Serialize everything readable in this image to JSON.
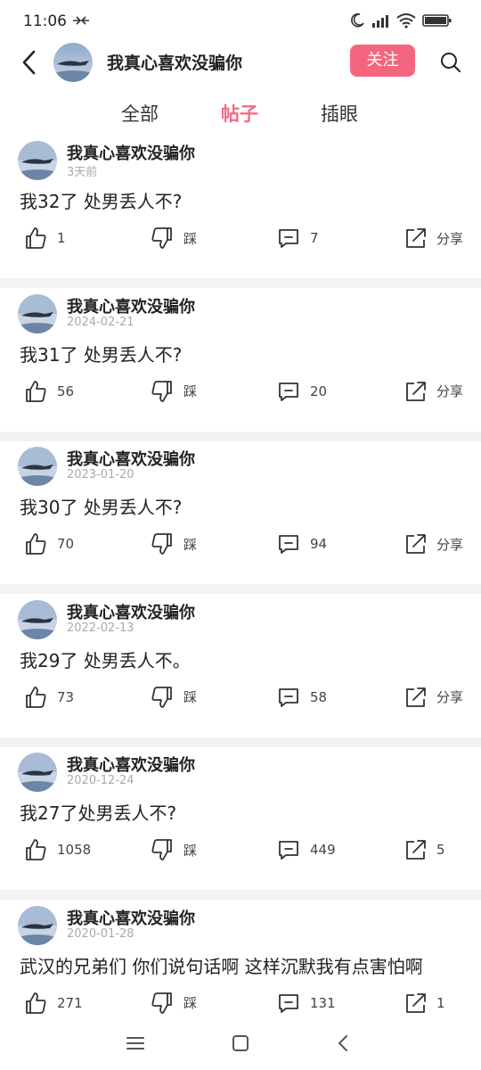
{
  "status_bar": {
    "time": "11:06"
  },
  "header": {
    "username": "我真心喜欢没骗你",
    "follow_label": "关注"
  },
  "tabs": [
    {
      "label": "全部",
      "active": false
    },
    {
      "label": "帖子",
      "active": true
    },
    {
      "label": "插眼",
      "active": false
    }
  ],
  "posts": [
    {
      "name": "我真心喜欢没骗你",
      "date": "3天前",
      "text": "我32了 处男丢人不?",
      "likes": "1",
      "dislike": "踩",
      "comments": "7",
      "share": "分享"
    },
    {
      "name": "我真心喜欢没骗你",
      "date": "2024-02-21",
      "text": "我31了 处男丢人不?",
      "likes": "56",
      "dislike": "踩",
      "comments": "20",
      "share": "分享"
    },
    {
      "name": "我真心喜欢没骗你",
      "date": "2023-01-20",
      "text": "我30了 处男丢人不?",
      "likes": "70",
      "dislike": "踩",
      "comments": "94",
      "share": "分享"
    },
    {
      "name": "我真心喜欢没骗你",
      "date": "2022-02-13",
      "text": "我29了 处男丢人不。",
      "likes": "73",
      "dislike": "踩",
      "comments": "58",
      "share": "分享"
    },
    {
      "name": "我真心喜欢没骗你",
      "date": "2020-12-24",
      "text": "我27了处男丢人不?",
      "likes": "1058",
      "dislike": "踩",
      "comments": "449",
      "share": "5"
    },
    {
      "name": "我真心喜欢没骗你",
      "date": "2020-01-28",
      "text": "武汉的兄弟们 你们说句话啊 这样沉默我有点害怕啊",
      "likes": "271",
      "dislike": "踩",
      "comments": "131",
      "share": "1"
    }
  ],
  "colors": {
    "accent": "#ee6d88",
    "follow_bg": "#f4667f",
    "separator": "#f3f3f3"
  },
  "icons": [
    "back-arrow-icon",
    "search-icon",
    "thumb-up-icon",
    "thumb-down-icon",
    "comment-icon",
    "share-icon",
    "menu-icon",
    "home-icon",
    "nav-back-icon"
  ]
}
